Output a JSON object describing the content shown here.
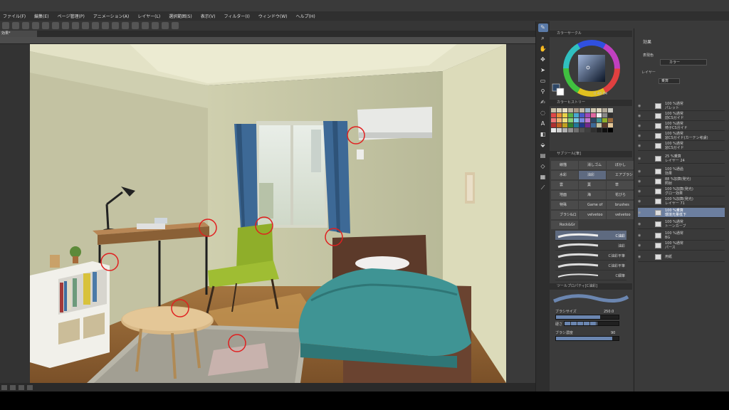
{
  "menu": [
    "ファイル(F)",
    "編集(E)",
    "ページ管理(P)",
    "アニメーション(A)",
    "レイヤー(L)",
    "選択範囲(S)",
    "表示(V)",
    "フィルター(I)",
    "ウィンドウ(W)",
    "ヘルプ(H)"
  ],
  "document": {
    "tab_label": "効果*"
  },
  "color_panel": {
    "title": "カラーサークル",
    "readout": "0  48  84"
  },
  "palette_panel": {
    "title": "カラーヒストリー"
  },
  "subtool_panel": {
    "title": "サブツール[筆]",
    "brushes": [
      "線描",
      "消しゴム",
      "ぼかし",
      "水彩",
      "油彩",
      "エアブラシ",
      "雲",
      "葉",
      "草",
      "地面",
      "海",
      "花びら",
      "特殊",
      "Game of",
      "brushes",
      "ブラシ&ロ",
      "velvetoo",
      "velvetoo",
      "Rock&Gr"
    ],
    "selected_brush": "油彩",
    "stroke_list": [
      "C油彩",
      "油彩",
      "C油彩平筆",
      "C油彩平筆",
      "C細筆"
    ]
  },
  "tool_property": {
    "title": "ツールプロパティ[C油彩]",
    "brush_size_label": "ブラシサイズ",
    "brush_size_value": "250.0",
    "hardness_label": "硬さ",
    "density_label": "ブラシ濃度",
    "density_value": "90"
  },
  "effects_panel": {
    "title": "効果",
    "display_color_label": "表現色",
    "display_color_value": "カラー"
  },
  "layer_panel": {
    "title": "レイヤー",
    "blend_mode": "乗算",
    "layers": [
      {
        "mode": "100 %通常",
        "name": "パレット",
        "selected": false
      },
      {
        "mode": "100 %通常",
        "name": "前CSガイド",
        "selected": false
      },
      {
        "mode": "100 %通常",
        "name": "椅子CSガイド",
        "selected": false
      },
      {
        "mode": "100 %通常",
        "name": "窓CSガイド(カーテン考慮)",
        "selected": false
      },
      {
        "mode": "100 %通常",
        "name": "窓CSガイド",
        "selected": false
      },
      {
        "mode": "25 %乗算",
        "name": "レイヤー 24",
        "selected": false
      },
      {
        "mode": "100 %通過",
        "name": "効果",
        "selected": false
      },
      {
        "mode": "88 %加算(発光)",
        "name": "照射",
        "selected": false
      },
      {
        "mode": "100 %加算(発光)",
        "name": "グロー効果",
        "selected": false
      },
      {
        "mode": "100 %加算(発光)",
        "name": "レイヤー 71",
        "selected": false
      },
      {
        "mode": "100 %乗算",
        "name": "環境光量低下",
        "selected": true
      },
      {
        "mode": "100 %通常",
        "name": "トーンカーブ",
        "selected": false
      },
      {
        "mode": "100 %通常",
        "name": "BG",
        "selected": false
      },
      {
        "mode": "100 %通常",
        "name": "パース",
        "selected": false
      },
      {
        "mode": "",
        "name": "用紙",
        "selected": false
      }
    ]
  },
  "colors": {
    "accent": "#6c7fa0",
    "wall": "#c9c8a7",
    "floor": "#9a6a3c",
    "curtain": "#3d6996",
    "bedding": "#3f9494",
    "chair": "#8fae2a",
    "markers": "#e02020"
  },
  "icons": {
    "pen_tool": "pen-icon",
    "eraser": "eraser-icon",
    "fill": "fill-icon"
  }
}
